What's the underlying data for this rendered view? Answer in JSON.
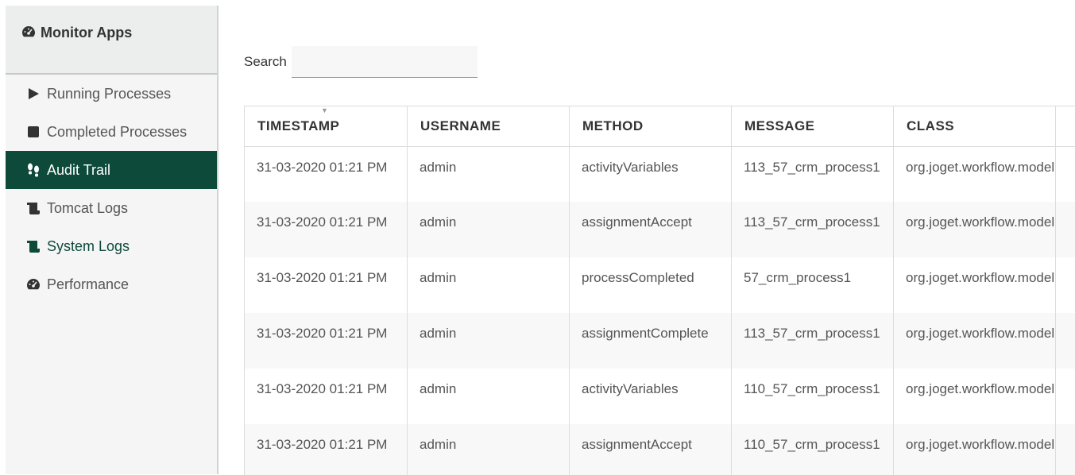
{
  "sidebar": {
    "header": {
      "icon": "dashboard-icon",
      "label": "Monitor Apps"
    },
    "items": [
      {
        "icon": "play-icon",
        "label": "Running Processes"
      },
      {
        "icon": "stop-icon",
        "label": "Completed Processes"
      },
      {
        "icon": "footsteps-icon",
        "label": "Audit Trail",
        "active": true
      },
      {
        "icon": "scroll-icon",
        "label": "Tomcat Logs"
      },
      {
        "icon": "scroll-icon",
        "label": "System Logs"
      },
      {
        "icon": "dashboard-icon",
        "label": "Performance"
      }
    ]
  },
  "search": {
    "label": "Search",
    "value": "",
    "placeholder": ""
  },
  "table": {
    "columns": [
      "TIMESTAMP",
      "USERNAME",
      "METHOD",
      "MESSAGE",
      "CLASS"
    ],
    "rows": [
      {
        "timestamp": "31-03-2020 01:21 PM",
        "username": "admin",
        "method": "activityVariables",
        "message": "113_57_crm_process1",
        "class": "org.joget.workflow.model"
      },
      {
        "timestamp": "31-03-2020 01:21 PM",
        "username": "admin",
        "method": "assignmentAccept",
        "message": "113_57_crm_process1",
        "class": "org.joget.workflow.model"
      },
      {
        "timestamp": "31-03-2020 01:21 PM",
        "username": "admin",
        "method": "processCompleted",
        "message": "57_crm_process1",
        "class": "org.joget.workflow.model"
      },
      {
        "timestamp": "31-03-2020 01:21 PM",
        "username": "admin",
        "method": "assignmentComplete",
        "message": "113_57_crm_process1",
        "class": "org.joget.workflow.model"
      },
      {
        "timestamp": "31-03-2020 01:21 PM",
        "username": "admin",
        "method": "activityVariables",
        "message": "110_57_crm_process1",
        "class": "org.joget.workflow.model"
      },
      {
        "timestamp": "31-03-2020 01:21 PM",
        "username": "admin",
        "method": "assignmentAccept",
        "message": "110_57_crm_process1",
        "class": "org.joget.workflow.model"
      }
    ]
  },
  "colors": {
    "accent": "#0d4a3a",
    "sidebar_bg": "#f5f5f5",
    "row_alt": "#f8f8f8"
  }
}
